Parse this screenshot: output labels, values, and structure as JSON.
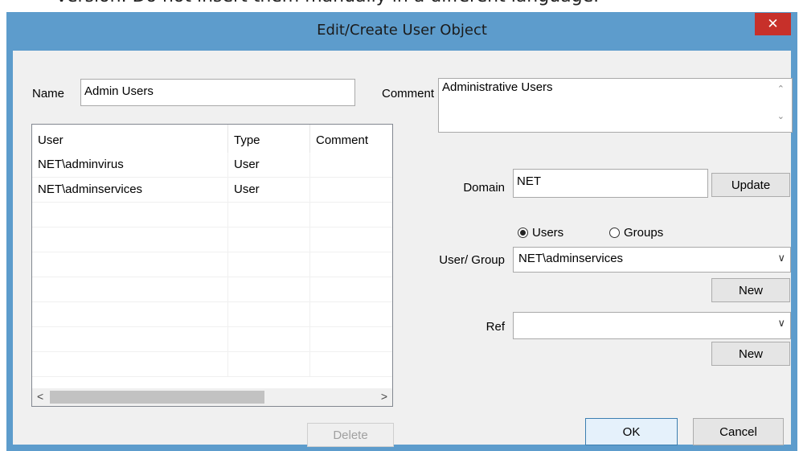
{
  "background_text": "version. Do not insert them manually in a different language.",
  "window": {
    "title": "Edit/Create User Object",
    "close_glyph": "✕"
  },
  "form": {
    "name_label": "Name",
    "name_value": "Admin Users",
    "comment_label": "Comment",
    "comment_value": "Administrative Users",
    "domain_label": "Domain",
    "domain_value": "NET",
    "update_label": "Update",
    "radio_users_label": "Users",
    "radio_groups_label": "Groups",
    "radio_selected": "Users",
    "user_group_label": "User/ Group",
    "user_group_value": "NET\\adminservices",
    "new_user_group_label": "New",
    "ref_label": "Ref",
    "ref_value": "",
    "new_ref_label": "New"
  },
  "list": {
    "columns": [
      "User",
      "Type",
      "Comment"
    ],
    "rows": [
      {
        "user": "NET\\adminvirus",
        "type": "User",
        "comment": ""
      },
      {
        "user": "NET\\adminservices",
        "type": "User",
        "comment": ""
      }
    ],
    "scroll_left": "<",
    "scroll_right": ">"
  },
  "buttons": {
    "delete_label": "Delete",
    "ok_label": "OK",
    "cancel_label": "Cancel"
  },
  "icons": {
    "scroll_up": "⌃",
    "scroll_down": "⌄",
    "dropdown": "∨"
  },
  "colors": {
    "titlebar": "#5d9ccc",
    "close_button": "#c7302a",
    "client": "#f0f0f0"
  }
}
